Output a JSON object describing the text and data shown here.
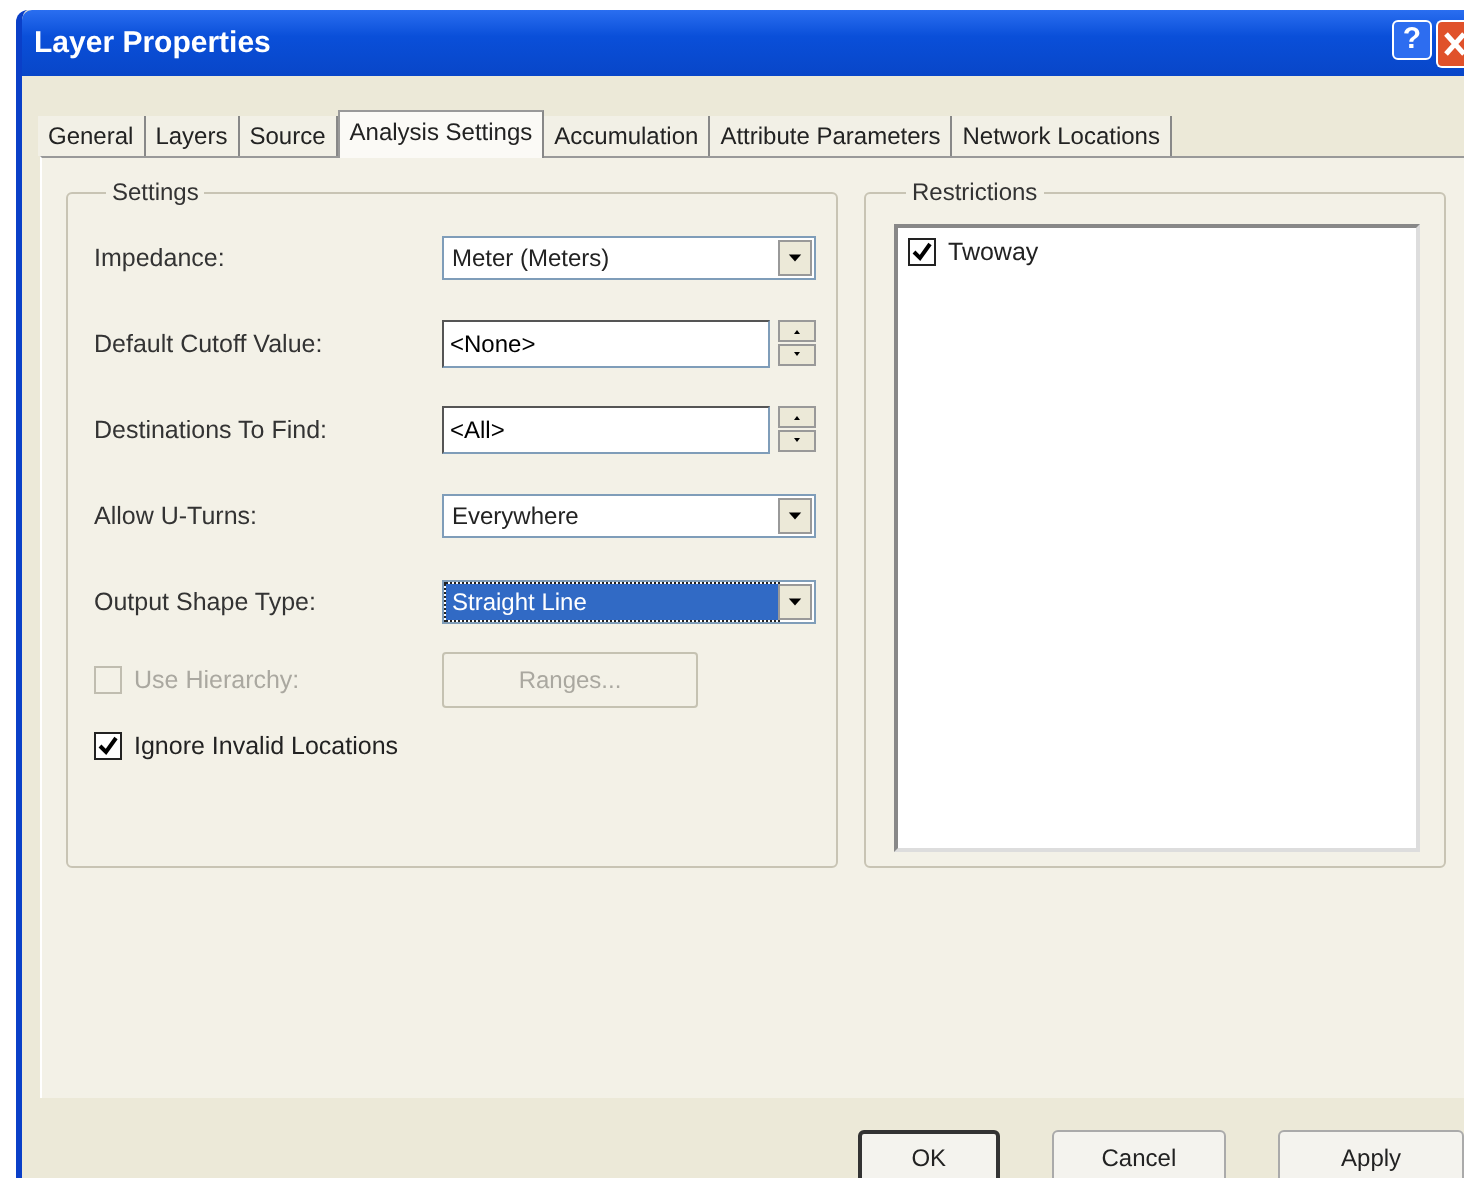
{
  "window": {
    "title": "Layer Properties",
    "help_button": "?"
  },
  "tabs": [
    {
      "label": "General",
      "selected": false
    },
    {
      "label": "Layers",
      "selected": false
    },
    {
      "label": "Source",
      "selected": false
    },
    {
      "label": "Analysis Settings",
      "selected": true
    },
    {
      "label": "Accumulation",
      "selected": false
    },
    {
      "label": "Attribute Parameters",
      "selected": false
    },
    {
      "label": "Network Locations",
      "selected": false
    }
  ],
  "settings": {
    "title": "Settings",
    "fields": [
      {
        "kind": "dropdown",
        "label": "Impedance:",
        "value": "Meter (Meters)",
        "highlighted": false
      },
      {
        "kind": "spin",
        "label": "Default Cutoff Value:",
        "value": "<None>",
        "highlighted": false
      },
      {
        "kind": "spin",
        "label": "Destinations To Find:",
        "value": "<All>",
        "highlighted": false
      },
      {
        "kind": "dropdown",
        "label": "Allow U-Turns:",
        "value": "Everywhere",
        "highlighted": false
      },
      {
        "kind": "dropdown",
        "label": "Output Shape Type:",
        "value": "Straight Line",
        "highlighted": true
      }
    ],
    "use_hierarchy": {
      "label": "Use Hierarchy:",
      "checked": false,
      "disabled": true
    },
    "ranges_button": {
      "label": "Ranges...",
      "disabled": true
    },
    "ignore_invalid_locations": {
      "label": "Ignore Invalid Locations",
      "checked": true,
      "disabled": false
    }
  },
  "restrictions": {
    "title": "Restrictions",
    "items": [
      {
        "label": "Twoway",
        "checked": true
      }
    ]
  },
  "buttons": [
    {
      "label": "OK",
      "default": true
    },
    {
      "label": "Cancel",
      "default": false
    },
    {
      "label": "Apply",
      "default": false
    }
  ]
}
